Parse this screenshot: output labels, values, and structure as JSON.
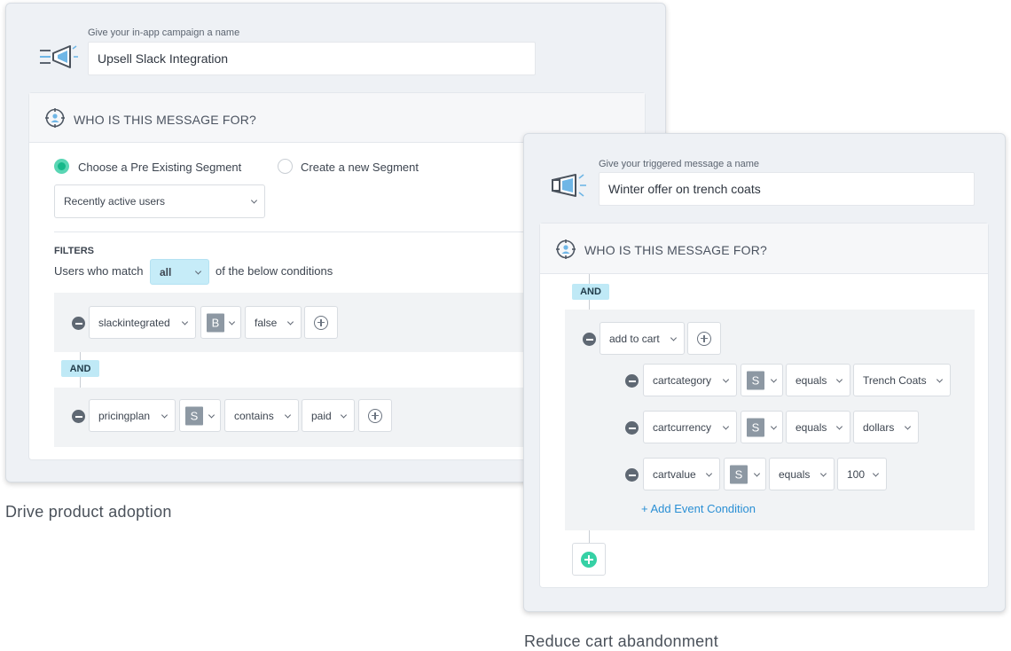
{
  "left_card": {
    "name_label": "Give your in-app campaign a name",
    "name_value": "Upsell Slack Integration",
    "section_title": "WHO IS THIS MESSAGE FOR?",
    "radio_existing": "Choose a Pre Existing Segment",
    "radio_new": "Create a new Segment",
    "segment_select": "Recently active users",
    "filters_label": "FILTERS",
    "match_prefix": "Users who match",
    "match_value": "all",
    "match_suffix": "of the below conditions",
    "and_label": "AND",
    "condition1": {
      "property": "slackintegrated",
      "type": "B",
      "operator": "false"
    },
    "condition2": {
      "property": "pricingplan",
      "type": "S",
      "operator": "contains",
      "value": "paid"
    }
  },
  "right_card": {
    "name_label": "Give your triggered message a name",
    "name_value": "Winter offer on trench coats",
    "section_title": "WHO IS THIS MESSAGE FOR?",
    "and_label": "AND",
    "event": "add to cart",
    "conditions": [
      {
        "property": "cartcategory",
        "type": "S",
        "operator": "equals",
        "value": "Trench Coats"
      },
      {
        "property": "cartcurrency",
        "type": "S",
        "operator": "equals",
        "value": "dollars"
      },
      {
        "property": "cartvalue",
        "type": "S",
        "operator": "equals",
        "value": "100"
      }
    ],
    "add_event_condition": "+ Add Event Condition"
  },
  "captions": {
    "left": "Drive product adoption",
    "right": "Reduce cart abandonment"
  },
  "colors": {
    "accent_green": "#17b88a",
    "and_tag": "#bfe9f6",
    "link_blue": "#2a8fd4"
  },
  "icons": [
    "megaphone-icon",
    "target-user-icon",
    "minus-circle-icon",
    "plus-circle-icon",
    "chevron-down-icon"
  ]
}
